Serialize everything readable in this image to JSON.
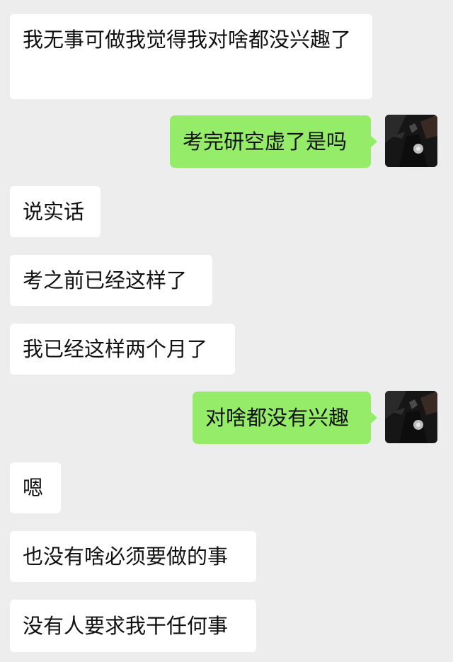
{
  "messages": [
    {
      "side": "in",
      "text": "我无事可做我觉得我对啥都没兴趣了"
    },
    {
      "side": "out",
      "text": "考完研空虚了是吗"
    },
    {
      "side": "in",
      "text": "说实话"
    },
    {
      "side": "in",
      "text": "考之前已经这样了"
    },
    {
      "side": "in",
      "text": "我已经这样两个月了"
    },
    {
      "side": "out",
      "text": "对啥都没有兴趣"
    },
    {
      "side": "in",
      "text": "嗯"
    },
    {
      "side": "in",
      "text": "也没有啥必须要做的事"
    },
    {
      "side": "in",
      "text": "没有人要求我干任何事"
    }
  ],
  "colors": {
    "background": "#ededed",
    "incoming_bubble": "#ffffff",
    "outgoing_bubble": "#95ec69",
    "text": "#111111"
  },
  "avatar_icon": "user-avatar-dark-photo"
}
